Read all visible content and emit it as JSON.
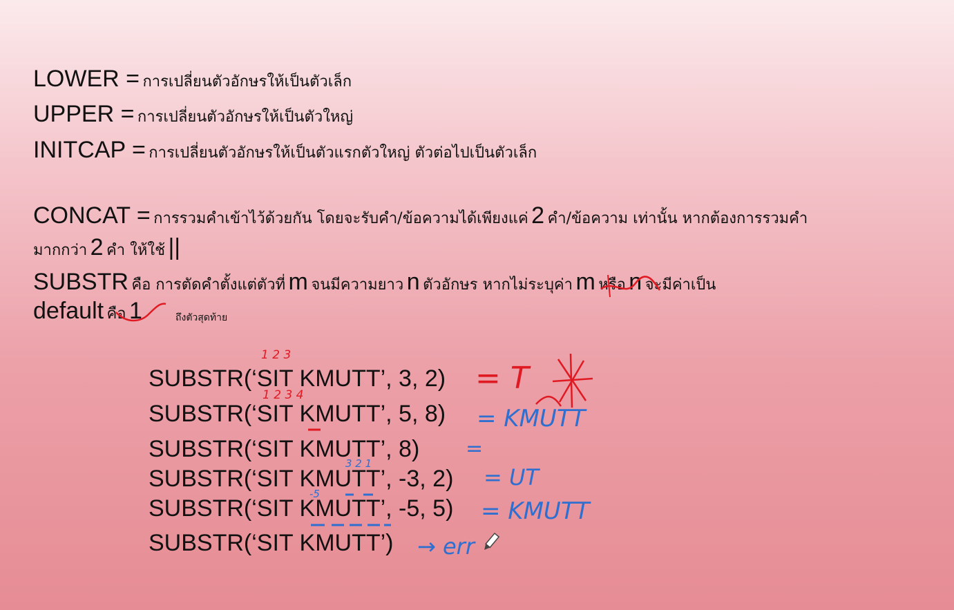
{
  "definitions": [
    {
      "term": "LOWER =",
      "desc": "การเปลี่ยนตัวอักษรให้เป็นตัวเล็ก"
    },
    {
      "term": "UPPER =",
      "desc": "การเปลี่ยนตัวอักษรให้เป็นตัวใหญ่"
    },
    {
      "term": "INITCAP =",
      "desc": "การเปลี่ยนตัวอักษรให้เป็นตัวแรกตัวใหญ่ ตัวต่อไปเป็นตัวเล็ก"
    }
  ],
  "concat": {
    "term": "CONCAT =",
    "desc_a": "การรวมคำเข้าไว้ด้วยกัน โดยจะรับคำ/ข้อความได้เพียงแค่",
    "num_a": "2",
    "desc_b": "คำ/ข้อความ เท่านั้น หากต้องการรวมคำ",
    "desc_c": "มากกว่า",
    "num_b": "2",
    "desc_d": "คำ ให้ใช้",
    "op": "||"
  },
  "substr_def": {
    "term": "SUBSTR",
    "desc_a": "คือ การตัดคำตั้งแต่ตัวที่",
    "m": "m",
    "desc_b": "จนมีความยาว",
    "n": "n",
    "desc_c": "ตัวอักษร หากไม่ระบุค่า",
    "m2": "m",
    "or": "หรือ",
    "n2": "n",
    "desc_d": "จะมีค่าเป็น",
    "default_word": "default",
    "is": "คือ",
    "default_val": "1",
    "note": "ถึงตัวสุดท้าย"
  },
  "examples": [
    {
      "expr": "SUBSTR(‘SIT KMUTT’, 3, 2)",
      "answer": "= T",
      "color": "red"
    },
    {
      "expr": "SUBSTR(‘SIT KMUTT’, 5, 8)",
      "answer": "= KMUTT",
      "color": "blue"
    },
    {
      "expr": "SUBSTR(‘SIT KMUTT’, 8)",
      "answer": "=",
      "color": "blue"
    },
    {
      "expr": "SUBSTR(‘SIT KMUTT’, -3, 2)",
      "answer": "= UT",
      "color": "blue"
    },
    {
      "expr": "SUBSTR(‘SIT KMUTT’, -5, 5)",
      "answer": "= KMUTT",
      "color": "blue"
    },
    {
      "expr": "SUBSTR(‘SIT KMUTT’)",
      "answer": "→ err",
      "color": "blue"
    }
  ],
  "annotations": {
    "count_a": "1 2 3",
    "count_b": "1 2 3 4",
    "count_c": "3 2 1",
    "count_d": "-5"
  },
  "colors": {
    "ink_red": "#e01a22",
    "ink_blue": "#2e6fd0"
  }
}
